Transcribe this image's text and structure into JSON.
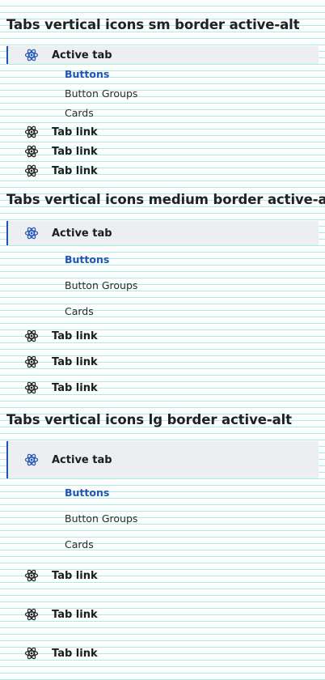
{
  "sections": [
    {
      "title": "Tabs vertical icons sm border active-alt",
      "active_tab": "Active tab",
      "sub_items": [
        "Buttons",
        "Button Groups",
        "Cards"
      ],
      "tab_links": [
        "Tab link",
        "Tab link",
        "Tab link"
      ]
    },
    {
      "title": "Tabs vertical icons medium border active-alt",
      "active_tab": "Active tab",
      "sub_items": [
        "Buttons",
        "Button Groups",
        "Cards"
      ],
      "tab_links": [
        "Tab link",
        "Tab link",
        "Tab link"
      ]
    },
    {
      "title": "Tabs vertical icons lg border active-alt",
      "active_tab": "Active tab",
      "sub_items": [
        "Buttons",
        "Button Groups",
        "Cards"
      ],
      "tab_links": [
        "Tab link",
        "Tab link",
        "Tab link"
      ]
    }
  ],
  "icons": {
    "tab_icon": "atom-icon"
  },
  "colors": {
    "accent": "#1f54b5",
    "active_bg": "#eceef2",
    "grid_line": "#a6f0e2"
  }
}
